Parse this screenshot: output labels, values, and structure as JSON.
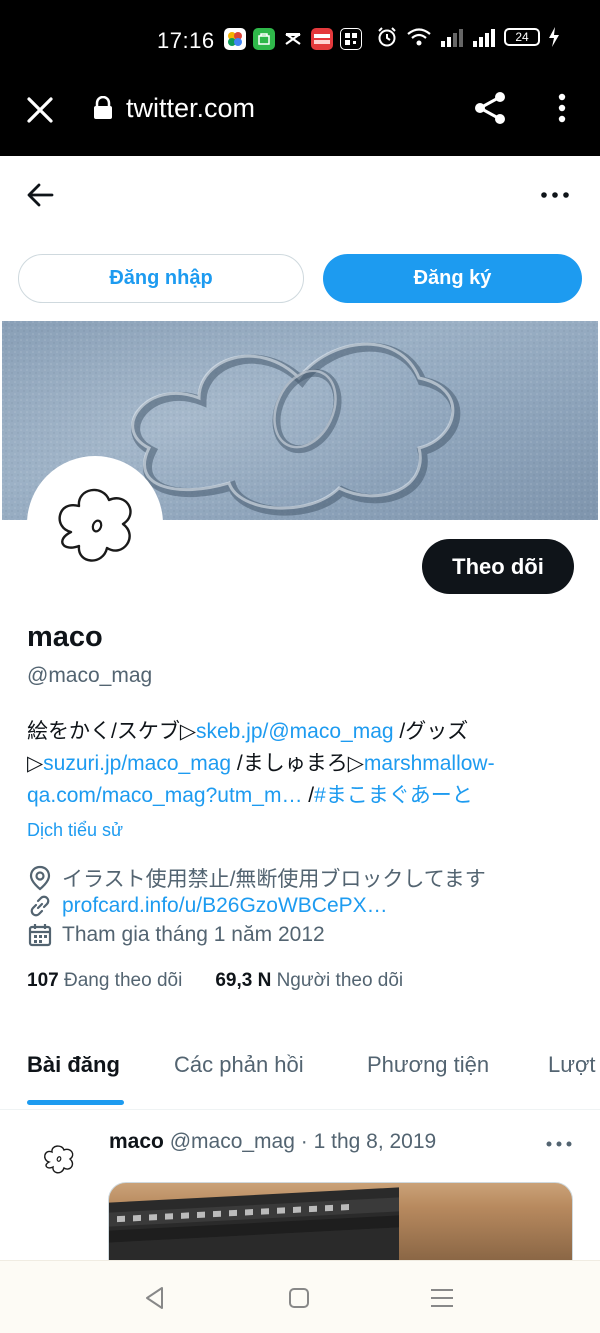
{
  "status_bar": {
    "time": "17:16",
    "battery": "24"
  },
  "browser": {
    "url": "twitter.com"
  },
  "header": {
    "login_label": "Đăng nhập",
    "signup_label": "Đăng ký"
  },
  "profile": {
    "follow_label": "Theo dõi",
    "name": "maco",
    "handle": "@maco_mag",
    "bio": {
      "t1": "絵をかく/スケブ▷",
      "l1": "skeb.jp/@maco_mag",
      "t2": " /グッズ",
      "t3": "▷",
      "l2": "suzuri.jp/maco_mag",
      "t4": " /ましゅまろ▷",
      "l3a": "marshmallow-",
      "l3b": "qa.com/maco_mag?utm_m…",
      "t5": " /",
      "l4": "#まこまぐあーと"
    },
    "translate_label": "Dịch tiểu sử",
    "location": "イラスト使用禁止/無断使用ブロックしてます",
    "website": "profcard.info/u/B26GzoWBCePX…",
    "joined": "Tham gia tháng 1 năm 2012",
    "following_count": "107",
    "following_label": "Đang theo dõi",
    "followers_count": "69,3 N",
    "followers_label": "Người theo dõi"
  },
  "tabs": [
    {
      "label": "Bài đăng"
    },
    {
      "label": "Các phản hồi"
    },
    {
      "label": "Phương tiện"
    },
    {
      "label": "Lượt"
    }
  ],
  "tweet": {
    "name": "maco",
    "handle": "@maco_mag",
    "sep": "·",
    "date": "1 thg 8, 2019"
  },
  "colors": {
    "accent": "#1d9bf0",
    "text": "#0f1419",
    "secondary": "#536471"
  }
}
